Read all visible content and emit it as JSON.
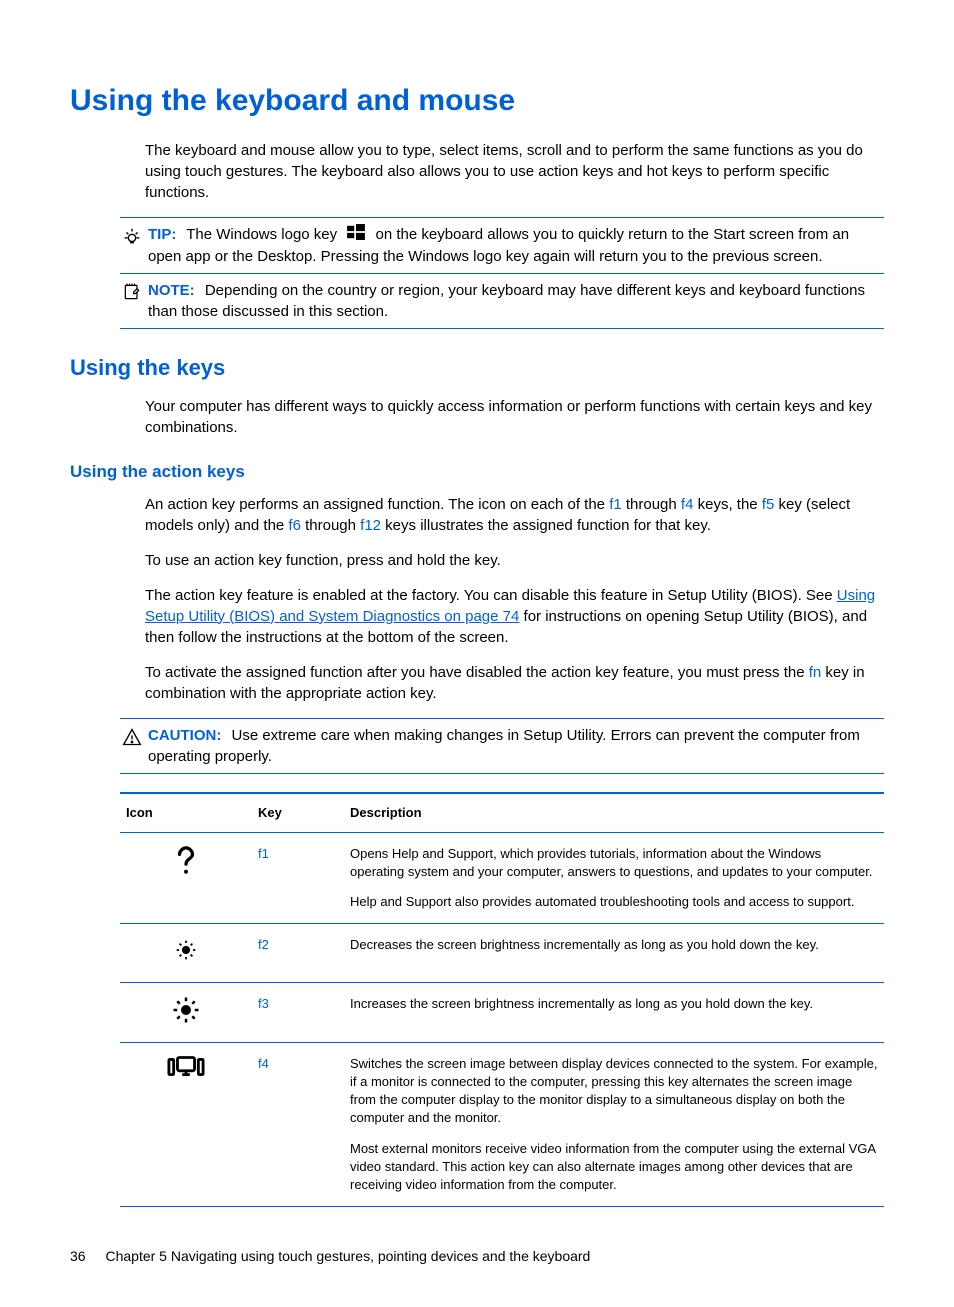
{
  "h1": "Using the keyboard and mouse",
  "intro": "The keyboard and mouse allow you to type, select items, scroll and to perform the same functions as you do using touch gestures. The keyboard also allows you to use action keys and hot keys to perform specific functions.",
  "tip": {
    "label": "TIP:",
    "pre": "The Windows logo key",
    "post": "on the keyboard allows you to quickly return to the Start screen from an open app or the Desktop. Pressing the Windows logo key again will return you to the previous screen."
  },
  "note": {
    "label": "NOTE:",
    "text": "Depending on the country or region, your keyboard may have different keys and keyboard functions than those discussed in this section."
  },
  "h2": "Using the keys",
  "keys_intro": "Your computer has different ways to quickly access information or perform functions with certain keys and key combinations.",
  "h3": "Using the action keys",
  "action_p1_a": "An action key performs an assigned function. The icon on each of the ",
  "action_p1_f1": "f1",
  "action_p1_b": " through ",
  "action_p1_f4": "f4",
  "action_p1_c": " keys, the ",
  "action_p1_f5": "f5",
  "action_p1_d": " key (select models only) and the ",
  "action_p1_f6": "f6",
  "action_p1_e": " through ",
  "action_p1_f12": "f12",
  "action_p1_f": " keys illustrates the assigned function for that key.",
  "action_p2": "To use an action key function, press and hold the key.",
  "action_p3_a": "The action key feature is enabled at the factory. You can disable this feature in Setup Utility (BIOS). See ",
  "action_p3_link": "Using Setup Utility (BIOS) and System Diagnostics on page 74",
  "action_p3_b": " for instructions on opening Setup Utility (BIOS), and then follow the instructions at the bottom of the screen.",
  "action_p4_a": "To activate the assigned function after you have disabled the action key feature, you must press the ",
  "action_p4_fn": "fn",
  "action_p4_b": " key in combination with the appropriate action key.",
  "caution": {
    "label": "CAUTION:",
    "text": "Use extreme care when making changes in Setup Utility. Errors can prevent the computer from operating properly."
  },
  "table": {
    "headers": {
      "icon": "Icon",
      "key": "Key",
      "desc": "Description"
    },
    "rows": [
      {
        "key": "f1",
        "desc_p1": "Opens Help and Support, which provides tutorials, information about the Windows operating system and your computer, answers to questions, and updates to your computer.",
        "desc_p2": "Help and Support also provides automated troubleshooting tools and access to support."
      },
      {
        "key": "f2",
        "desc_p1": "Decreases the screen brightness incrementally as long as you hold down the key."
      },
      {
        "key": "f3",
        "desc_p1": "Increases the screen brightness incrementally as long as you hold down the key."
      },
      {
        "key": "f4",
        "desc_p1": "Switches the screen image between display devices connected to the system. For example, if a monitor is connected to the computer, pressing this key alternates the screen image from the computer display to the monitor display to a simultaneous display on both the computer and the monitor.",
        "desc_p2": "Most external monitors receive video information from the computer using the external VGA video standard. This action key can also alternate images among other devices that are receiving video information from the computer."
      }
    ]
  },
  "footer": {
    "page": "36",
    "chapter": "Chapter 5   Navigating using touch gestures, pointing devices and the keyboard"
  }
}
